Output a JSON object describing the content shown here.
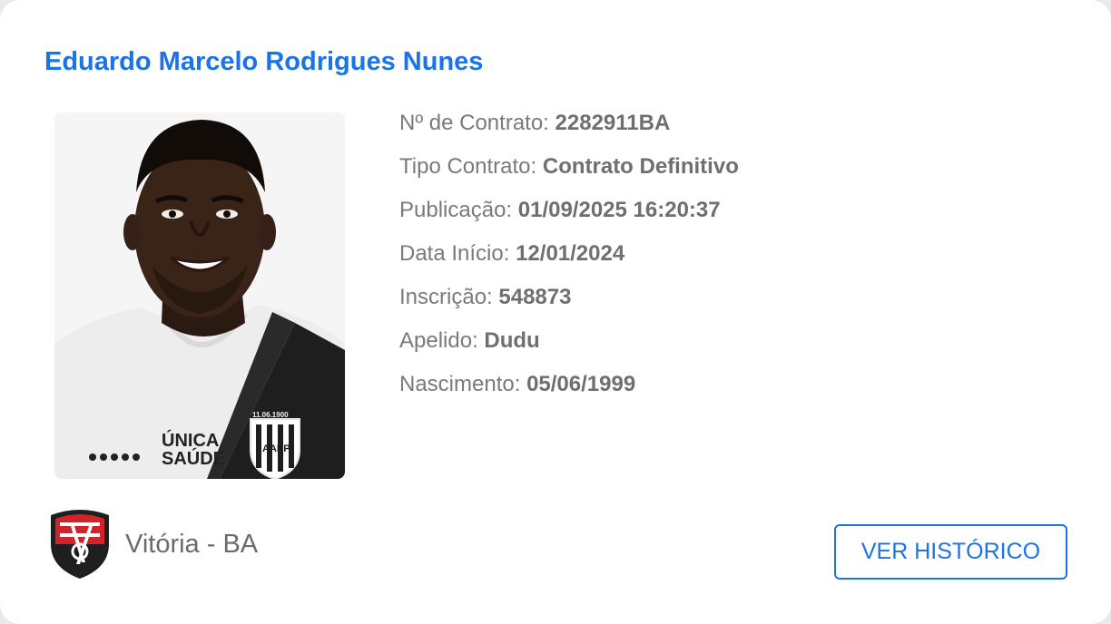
{
  "player": {
    "name": "Eduardo Marcelo Rodrigues Nunes",
    "photo_alt": "Eduardo Marcelo Rodrigues Nunes"
  },
  "details": [
    {
      "label": "Nº de Contrato:",
      "value": "2282911BA"
    },
    {
      "label": "Tipo Contrato:",
      "value": "Contrato Definitivo"
    },
    {
      "label": "Publicação:",
      "value": "01/09/2025 16:20:37"
    },
    {
      "label": "Data Início:",
      "value": "12/01/2024"
    },
    {
      "label": "Inscrição:",
      "value": "548873"
    },
    {
      "label": "Apelido:",
      "value": "Dudu"
    },
    {
      "label": "Nascimento:",
      "value": "05/06/1999"
    }
  ],
  "club": {
    "name": "Vitória - BA",
    "crest_icon": "club-crest-icon"
  },
  "actions": {
    "history_label": "VER HISTÓRICO"
  },
  "jersey": {
    "sponsor_line1": "ÚNICA",
    "sponsor_line2": "SAÚDE",
    "badge_text": "AAPP",
    "badge_date": "11.06.1900"
  },
  "colors": {
    "accent": "#1a73e8",
    "label_text": "#7a7a7a",
    "value_text": "#6f6f6f",
    "crest_red": "#d2232a",
    "crest_black": "#1e1e1e"
  }
}
